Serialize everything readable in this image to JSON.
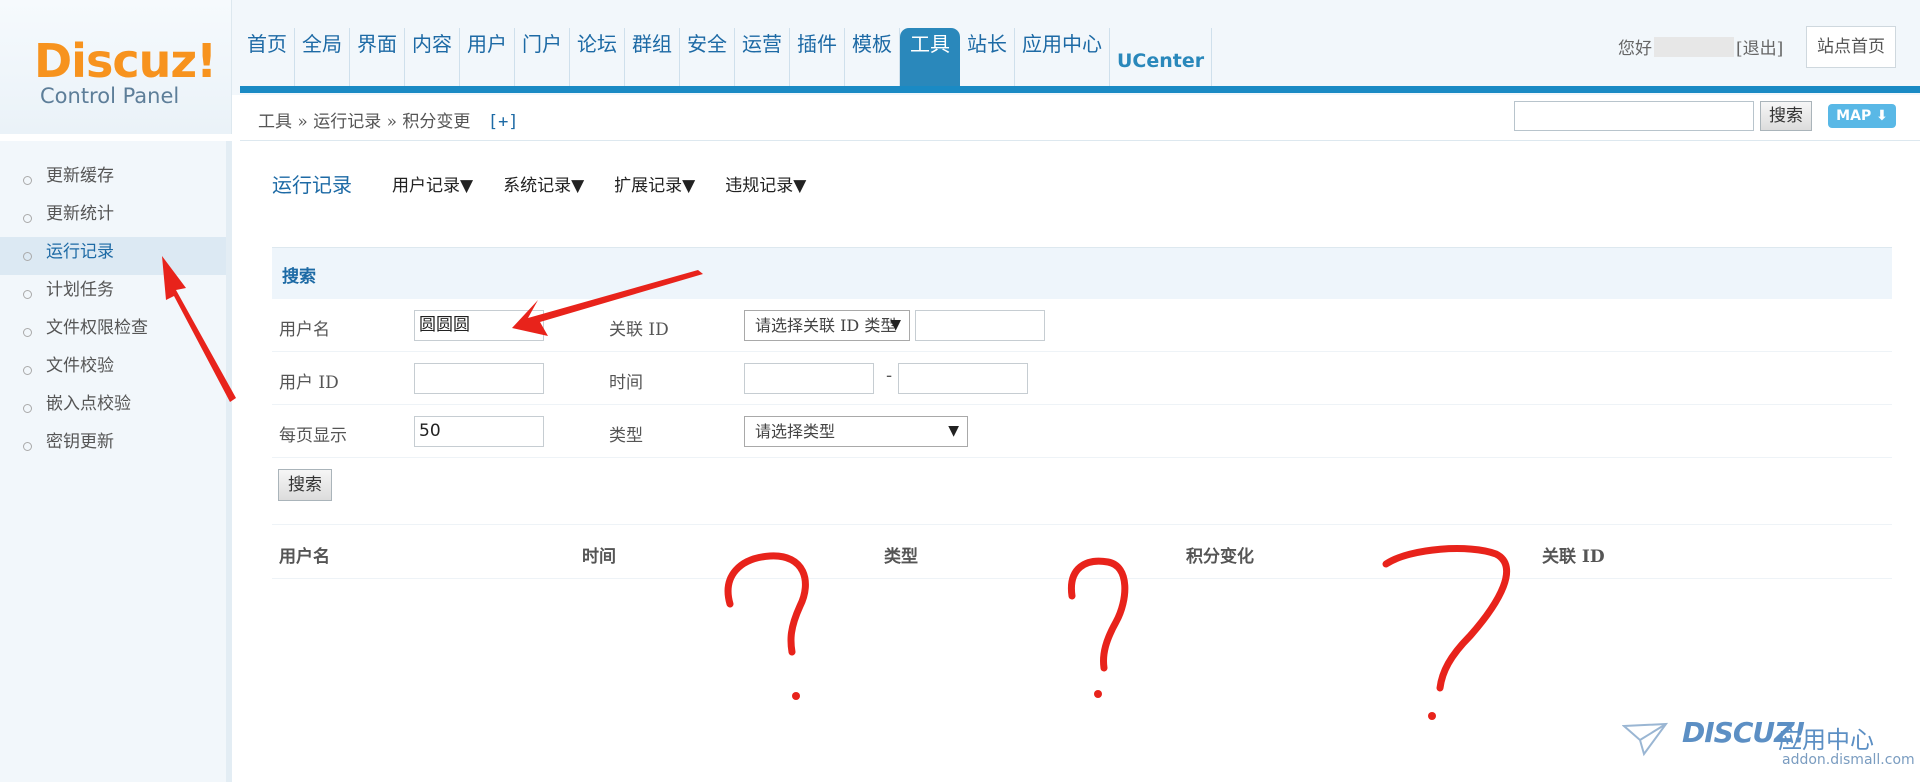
{
  "logo": {
    "title": "Discuz!",
    "subtitle": "Control Panel"
  },
  "topnav": {
    "items": [
      "首页",
      "全局",
      "界面",
      "内容",
      "用户",
      "门户",
      "论坛",
      "群组",
      "安全",
      "运营",
      "插件",
      "模板",
      "工具",
      "站长",
      "应用中心",
      "UCenter"
    ],
    "active_index": 12
  },
  "user": {
    "greeting": "您好",
    "logout": "[退出]",
    "site_home": "站点首页"
  },
  "breadcrumb": {
    "text": "工具 » 运行记录 » 积分变更",
    "add": "[+]"
  },
  "top_search": {
    "button": "搜索",
    "map": "MAP"
  },
  "sidebar": {
    "items": [
      "更新缓存",
      "更新统计",
      "运行记录",
      "计划任务",
      "文件权限检查",
      "文件校验",
      "嵌入点校验",
      "密钥更新"
    ],
    "active_index": 2
  },
  "subnav": {
    "current": "运行记录",
    "menus": [
      "用户记录▼",
      "系统记录▼",
      "扩展记录▼",
      "违规记录▼"
    ]
  },
  "form": {
    "section_title": "搜索",
    "username_label": "用户名",
    "username_value": "圆圆圆",
    "relid_label": "关联 ID",
    "relid_select": "请选择关联 ID 类型",
    "uid_label": "用户 ID",
    "time_label": "时间",
    "time_sep": "-",
    "perpage_label": "每页显示",
    "perpage_value": "50",
    "type_label": "类型",
    "type_select": "请选择类型",
    "submit": "搜索"
  },
  "table": {
    "headers": [
      "用户名",
      "时间",
      "类型",
      "积分变化",
      "关联 ID"
    ]
  },
  "annotations": {
    "color": "#e8231b",
    "marks": [
      "?",
      "?",
      "?"
    ]
  },
  "watermark": {
    "brand": "DISCUZ!",
    "label": "应用中心",
    "url": "addon.dismall.com"
  }
}
